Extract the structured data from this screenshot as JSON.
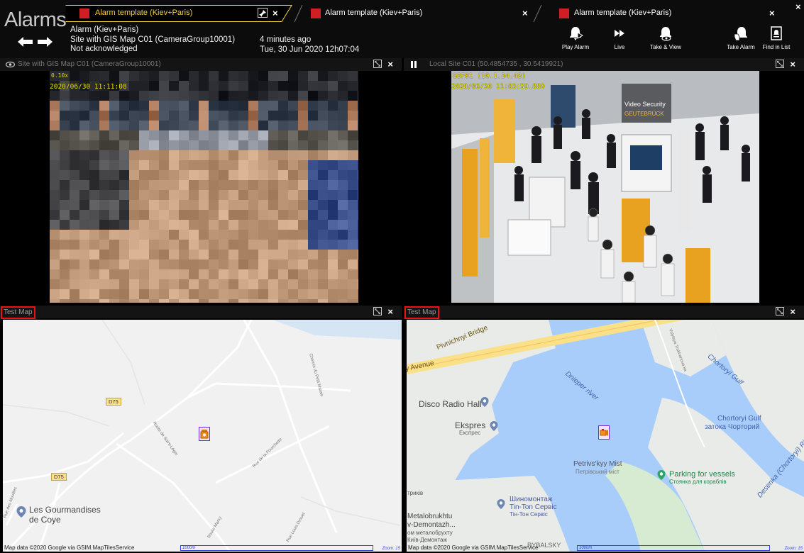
{
  "app": {
    "title": "Alarms",
    "window_close": "×"
  },
  "tabs": [
    {
      "label": "Alarm template (Kiev+Paris)",
      "close": "×",
      "active": true
    },
    {
      "label": "Alarm template (Kiev+Paris)",
      "close": "×",
      "active": false
    },
    {
      "label": "Alarm template (Kiev+Paris)",
      "close": "×",
      "active": false
    }
  ],
  "alarm": {
    "name": "Alarm (Kiev+Paris)",
    "site": "Site with GIS Map C01 (CameraGroup10001)",
    "status": "Not acknowledged",
    "age": "4 minutes ago",
    "datetime": "Tue, 30 Jun 2020  12h07:04"
  },
  "toolbar": [
    {
      "label": "Play Alarm",
      "icon": "bell-play-icon"
    },
    {
      "label": "Live",
      "icon": "fast-forward-icon"
    },
    {
      "label": "Take & View",
      "icon": "bell-eye-icon"
    },
    {
      "label": "Take Alarm",
      "icon": "bell-hand-icon"
    },
    {
      "label": "Find in List",
      "icon": "list-alarm-icon"
    }
  ],
  "panes": {
    "video_left": {
      "title": "Site with GIS Map C01 (CameraGroup10001)",
      "osd_tag": "0.10x",
      "osd_time": "2020/06/30 11:11:08"
    },
    "video_right": {
      "title": "Local Site C01 (50.4854735 , 30.5419921)",
      "osd_tag": "GBF01 (10.1.34.48)",
      "osd_time": "2020/06/30 11:03:59.889",
      "booth_sign_1": "Video Security",
      "booth_sign_2": "GEUTEBRÜCK"
    },
    "map_left": {
      "title": "Test Map",
      "attribution": "Map data ©2020 Google via GSIM.MapTilesService",
      "scale": "1000m",
      "zoom": "Zoom: 15",
      "labels": {
        "d075_a": "D75",
        "d075_b": "D75",
        "poi": "Les Gourmandises",
        "poi2": "de Coye",
        "r1": "Route de Saint-Léger",
        "r2": "Rue de la Fourchette",
        "r3": "Chemin du Petit Marais",
        "r4": "Rue des Mouilles",
        "r5": "Route Mamy",
        "r6": "Rue Louis Drouet"
      }
    },
    "map_right": {
      "title": "Test Map",
      "attribution": "Map data ©2020 Google via GSIM.MapTilesService",
      "scale": "1000m",
      "zoom": "Zoom: 15",
      "labels": {
        "bridge": "Pivnichnyi Bridge",
        "avenue": "y Avenue",
        "disco": "Disco Radio Hall",
        "ekspres": "Ekspres",
        "ekspres_ua": "Експрес",
        "dnieper": "Dnieper river",
        "gulf1": "Chortoryi Gulf",
        "gulf2": "Chortoryi Gulf",
        "gulf2_ua": "затока Чорторий",
        "mist": "Petrivs'kyy Mist",
        "mist_ua": "Петрівський міст",
        "parking": "Parking for vessels",
        "parking_ua": "Стоянка для кораблів",
        "tyre": "Шиномонтаж",
        "tyre2": "Tin-Ton Сервіс",
        "tyre3": "Тін-Тон Сервіс",
        "metal1": "Metalobrukhtu",
        "metal2": "v-Demontazh...",
        "metal3": "ом металобрухту",
        "metal4": "Київ-Демонтаж",
        "trikiv": "трикiв",
        "rybalsky": "RYBALSKY",
        "desenka": "Desenka (Chortoryi) River",
        "street1": "Vulytsya Trukhanova ka"
      }
    }
  },
  "colors": {
    "accent": "#f6d23a",
    "alarm_red": "#d01f24",
    "water": "#a9cdfb",
    "land": "#f1f1f1",
    "highlight": "#e11111",
    "marker": "#6a2ad9"
  }
}
